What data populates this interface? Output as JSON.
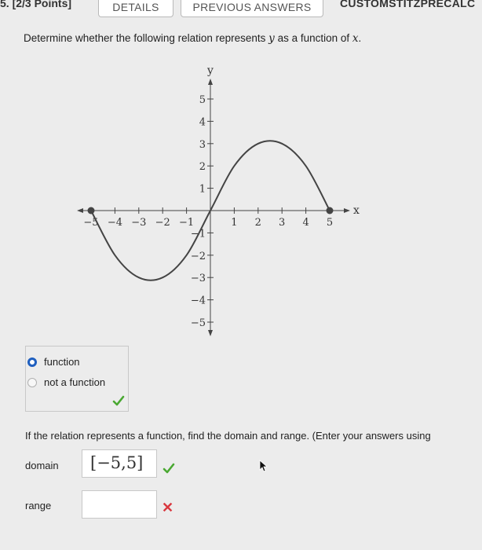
{
  "header": {
    "points": "5. [2/3 Points]",
    "tabs": [
      "DETAILS",
      "PREVIOUS ANSWERS"
    ],
    "custom": "CUSTOMSTITZPRECALC"
  },
  "question": {
    "prompt_prefix": "Determine whether the following relation represents ",
    "var_y": "y",
    "prompt_middle": " as a function of ",
    "var_x": "x",
    "prompt_end": ".",
    "options": [
      "function",
      "not a function"
    ],
    "selected_option": "function",
    "part2": "If the relation represents a function, find the domain and range. (Enter your answers using",
    "domain_label": "domain",
    "domain_value": "[−5,5]",
    "domain_status": "correct",
    "range_label": "range",
    "range_value": "",
    "range_status": "incorrect"
  },
  "graph": {
    "x_axis_label": "x",
    "y_axis_label": "y",
    "x_ticks": [
      -5,
      -4,
      -3,
      -2,
      -1,
      1,
      2,
      3,
      4,
      5
    ],
    "y_ticks": [
      -5,
      -4,
      -3,
      -2,
      -1,
      1,
      2,
      3,
      4,
      5
    ],
    "x_range": [
      -5,
      5
    ],
    "y_range": [
      -5,
      5
    ],
    "curve_color": "#444444",
    "curve_points": [
      [
        -5,
        0
      ],
      [
        -4,
        -2
      ],
      [
        -3,
        -3
      ],
      [
        -2,
        -3
      ],
      [
        -1,
        -2
      ],
      [
        0,
        0
      ],
      [
        1,
        2
      ],
      [
        2,
        3
      ],
      [
        3,
        3
      ],
      [
        4,
        2
      ],
      [
        5,
        0
      ]
    ],
    "endpoints": [
      [
        -5,
        0
      ],
      [
        5,
        0
      ]
    ]
  },
  "colors": {
    "check": "#4aa832",
    "cross": "#d9383f",
    "radio_selected": "#1f5fbf"
  },
  "icons": [
    "check-icon",
    "cross-icon",
    "cursor-icon"
  ]
}
